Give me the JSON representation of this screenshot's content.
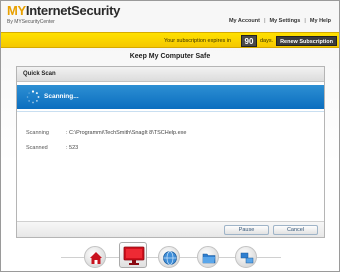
{
  "app": {
    "logo_my": "MY",
    "logo_rest": "InternetSecurity",
    "logo_sub": "By MYSecurityCenter"
  },
  "topnav": {
    "account": "My Account",
    "settings": "My Settings",
    "help": "My Help"
  },
  "subscription": {
    "text": "Your subscription expires in",
    "days": "90",
    "days_label": "days.",
    "renew": "Renew Subscription"
  },
  "page": {
    "title": "Keep My Computer Safe"
  },
  "panel": {
    "title": "Quick Scan",
    "status": "Scanning...",
    "scanning_label": "Scanning",
    "scanning_value": ": C:\\Programmi\\TechSmith\\SnagIt 8\\TSCHelp.exe",
    "scanned_label": "Scanned",
    "scanned_value": ": 523",
    "pause": "Pause",
    "cancel": "Cancel"
  },
  "colors": {
    "accent_yellow": "#ffe100",
    "scan_blue": "#1a7cc9",
    "logo_orange": "#e8a000"
  },
  "dock": {
    "items": [
      "home-icon",
      "monitor-icon",
      "globe-icon",
      "folder-icon",
      "network-icon"
    ],
    "active": "monitor-icon"
  }
}
